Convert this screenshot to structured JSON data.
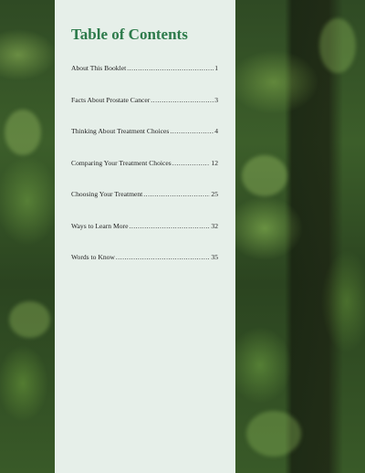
{
  "title": "Table of Contents",
  "entries": [
    {
      "label": "About This Booklet",
      "page": "1"
    },
    {
      "label": "Facts About Prostate Cancer",
      "page": "3"
    },
    {
      "label": "Thinking About Treatment Choices",
      "page": "4"
    },
    {
      "label": "Comparing Your Treatment Choices",
      "page": "12"
    },
    {
      "label": "Choosing Your Treatment",
      "page": "25"
    },
    {
      "label": "Ways to Learn More",
      "page": "32"
    },
    {
      "label": "Words to Know",
      "page": "35"
    }
  ]
}
